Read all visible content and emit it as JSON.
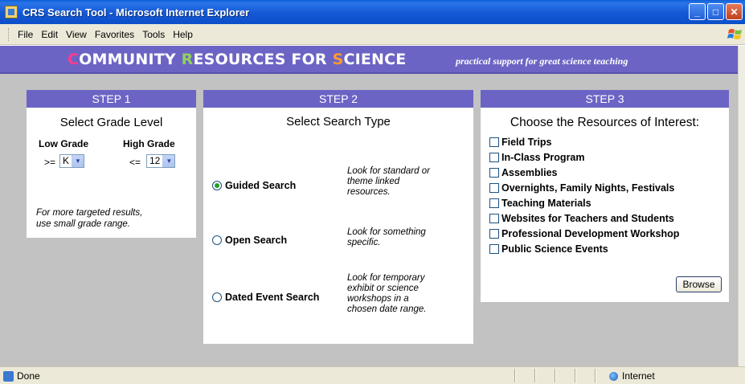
{
  "window": {
    "title": "CRS Search Tool - Microsoft Internet Explorer"
  },
  "menu": [
    "File",
    "Edit",
    "View",
    "Favorites",
    "Tools",
    "Help"
  ],
  "banner": {
    "title_letters": {
      "c": "C",
      "r": "R",
      "s": "S"
    },
    "title_parts": [
      "OMMUNITY ",
      "ESOURCES FOR ",
      "CIENCE"
    ],
    "tagline": "practical support for great science teaching",
    "colors": {
      "c": "#ff3b8c",
      "r": "#8fd35a",
      "s": "#ff9a2e",
      "band": "#6c64c4"
    }
  },
  "step1": {
    "header": "STEP 1",
    "title": "Select Grade Level",
    "low_label": "Low Grade",
    "high_label": "High Grade",
    "low_op": ">=",
    "low_value": "K",
    "high_op": "<=",
    "high_value": "12",
    "hint": [
      "For more targeted results,",
      "use small grade range."
    ]
  },
  "step2": {
    "header": "STEP 2",
    "title": "Select Search Type",
    "options": [
      {
        "label": "Guided Search",
        "checked": true,
        "desc": [
          "Look for standard or",
          "theme linked",
          "resources."
        ]
      },
      {
        "label": "Open Search",
        "checked": false,
        "desc": [
          "Look for something",
          "specific."
        ]
      },
      {
        "label": "Dated Event Search",
        "checked": false,
        "desc": [
          "Look for temporary",
          "exhibit or science",
          "workshops in a",
          "chosen date range."
        ]
      }
    ]
  },
  "step3": {
    "header": "STEP 3",
    "title": "Choose  the Resources of Interest:",
    "resources": [
      "Field Trips",
      "In-Class Program",
      "Assemblies",
      "Overnights, Family Nights, Festivals",
      "Teaching Materials",
      "Websites for Teachers and Students",
      "Professional Development Workshop",
      "Public Science Events"
    ],
    "browse_label": "Browse"
  },
  "status": {
    "left": "Done",
    "zone": "Internet"
  }
}
